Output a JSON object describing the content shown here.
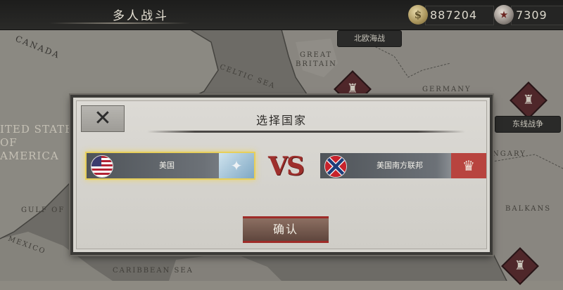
{
  "topbar": {
    "title": "多人战斗",
    "gold_amount": "887204",
    "medal_amount": "7309",
    "gold_icon": "gold-coin-icon",
    "medal_icon": "medal-coin-icon"
  },
  "map": {
    "labels": {
      "canada": "CANADA",
      "great_britain_1": "GREAT",
      "great_britain_2": "BRITAIN",
      "germany": "GERMANY",
      "celtic_sea": "CELTIC SEA",
      "usa_1": "ITED STATES",
      "usa_2": "OF",
      "usa_3": "AMERICA",
      "gulf": "GULF OF M",
      "mexico": "MEXICO",
      "caribbean": "CARIBBEAN SEA",
      "hungary": "NGARY",
      "balkans": "BALKANS"
    },
    "battle_tags": {
      "north_sea": "北欧海战",
      "east_front": "东线战争"
    }
  },
  "dialog": {
    "title": "选择国家",
    "close_icon": "close-icon",
    "vs_text": "VS",
    "left_nation": {
      "name": "美国",
      "flag": "usa-flag-icon",
      "emblem": "eagle-emblem-icon",
      "selected": true
    },
    "right_nation": {
      "name": "美国南方联邦",
      "flag": "confederate-flag-icon",
      "emblem": "crown-emblem-icon",
      "selected": false
    },
    "confirm_label": "确认"
  },
  "colors": {
    "accent_red": "#9e2f2c",
    "selection_gold": "#e7cf5a",
    "crown_red": "#b8443f"
  }
}
